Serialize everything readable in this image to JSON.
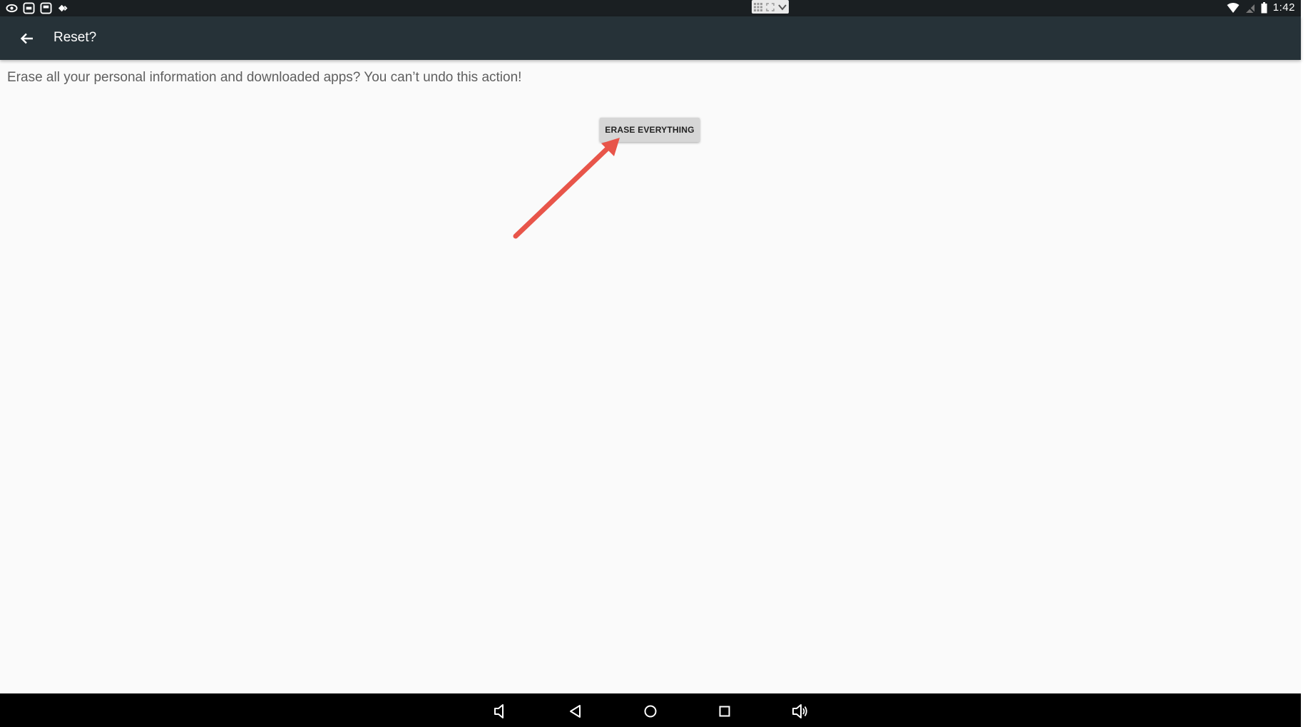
{
  "status_bar": {
    "time": "1:42",
    "left_icons": [
      "eye-icon",
      "app-icon",
      "app-icon",
      "diamond-icon"
    ],
    "right_icons": [
      "wifi-icon",
      "no-signal-icon",
      "battery-icon"
    ]
  },
  "toolbar": {
    "title": "Reset?",
    "back_icon": "arrow-back-icon"
  },
  "content": {
    "message": "Erase all your personal information and downloaded apps? You can’t undo this action!",
    "erase_button_label": "ERASE EVERYTHING"
  },
  "annotation": {
    "color": "#e8554a"
  },
  "nav_bar": {
    "buttons": [
      "volume-down-icon",
      "back-icon",
      "home-icon",
      "recents-icon",
      "volume-up-icon"
    ]
  },
  "colors": {
    "toolbar": "#263238",
    "status_bar": "#1a1f22",
    "background": "#fafafa",
    "button": "#d6d6d6"
  }
}
